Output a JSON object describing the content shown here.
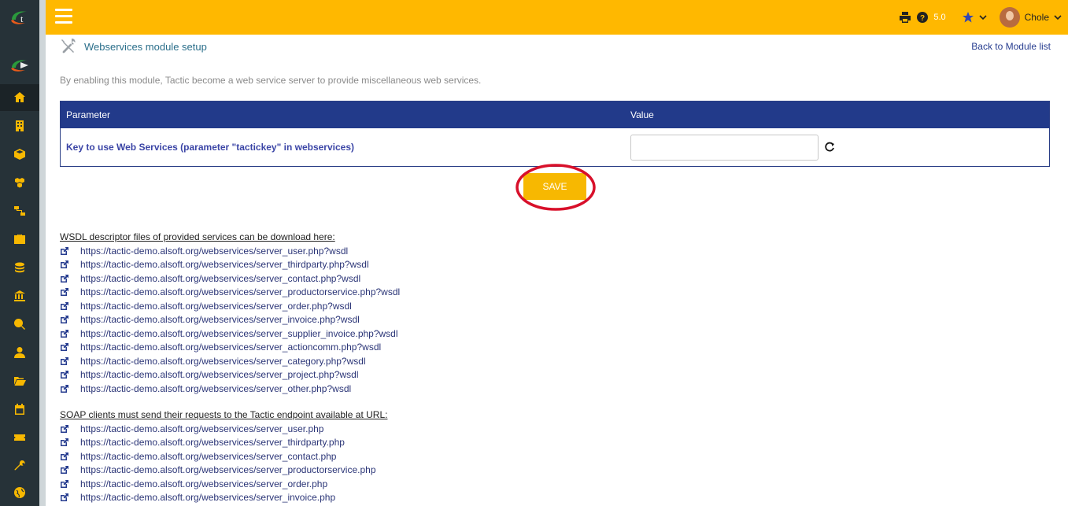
{
  "app": {
    "logo_letter": "t"
  },
  "sidebar": {
    "items": [
      {
        "icon": "home-icon",
        "active": true
      },
      {
        "icon": "building-icon"
      },
      {
        "icon": "cube-icon"
      },
      {
        "icon": "cubes-icon"
      },
      {
        "icon": "sitemap-icon"
      },
      {
        "icon": "briefcase-icon"
      },
      {
        "icon": "coins-icon"
      },
      {
        "icon": "bank-icon"
      },
      {
        "icon": "search-dollar-icon"
      },
      {
        "icon": "user-tie-icon"
      },
      {
        "icon": "folder-open-icon"
      },
      {
        "icon": "calendar-icon"
      },
      {
        "icon": "ticket-icon"
      },
      {
        "icon": "wrench-icon"
      },
      {
        "icon": "globe-icon"
      }
    ]
  },
  "topbar": {
    "version": "5.0",
    "user_name": "Chole"
  },
  "page": {
    "title": "Webservices module setup",
    "back_link": "Back to Module list",
    "intro": "By enabling this module, Tactic become a web service server to provide miscellaneous web services."
  },
  "table": {
    "headers": [
      "Parameter",
      "Value"
    ],
    "row_label": "Key to use Web Services (parameter \"tactickey\" in webservices)",
    "input_value": ""
  },
  "save_label": "SAVE",
  "wsdl": {
    "heading": "WSDL descriptor files of provided services can be download here:",
    "links": [
      "https://tactic-demo.alsoft.org/webservices/server_user.php?wsdl",
      "https://tactic-demo.alsoft.org/webservices/server_thirdparty.php?wsdl",
      "https://tactic-demo.alsoft.org/webservices/server_contact.php?wsdl",
      "https://tactic-demo.alsoft.org/webservices/server_productorservice.php?wsdl",
      "https://tactic-demo.alsoft.org/webservices/server_order.php?wsdl",
      "https://tactic-demo.alsoft.org/webservices/server_invoice.php?wsdl",
      "https://tactic-demo.alsoft.org/webservices/server_supplier_invoice.php?wsdl",
      "https://tactic-demo.alsoft.org/webservices/server_actioncomm.php?wsdl",
      "https://tactic-demo.alsoft.org/webservices/server_category.php?wsdl",
      "https://tactic-demo.alsoft.org/webservices/server_project.php?wsdl",
      "https://tactic-demo.alsoft.org/webservices/server_other.php?wsdl"
    ]
  },
  "soap": {
    "heading": "SOAP clients must send their requests to the Tactic endpoint available at URL:",
    "links": [
      "https://tactic-demo.alsoft.org/webservices/server_user.php",
      "https://tactic-demo.alsoft.org/webservices/server_thirdparty.php",
      "https://tactic-demo.alsoft.org/webservices/server_contact.php",
      "https://tactic-demo.alsoft.org/webservices/server_productorservice.php",
      "https://tactic-demo.alsoft.org/webservices/server_order.php",
      "https://tactic-demo.alsoft.org/webservices/server_invoice.php"
    ]
  },
  "colors": {
    "accent": "#ffb800",
    "sidebar": "#263238",
    "table_header": "#223a8a",
    "highlight": "#d8102a"
  }
}
